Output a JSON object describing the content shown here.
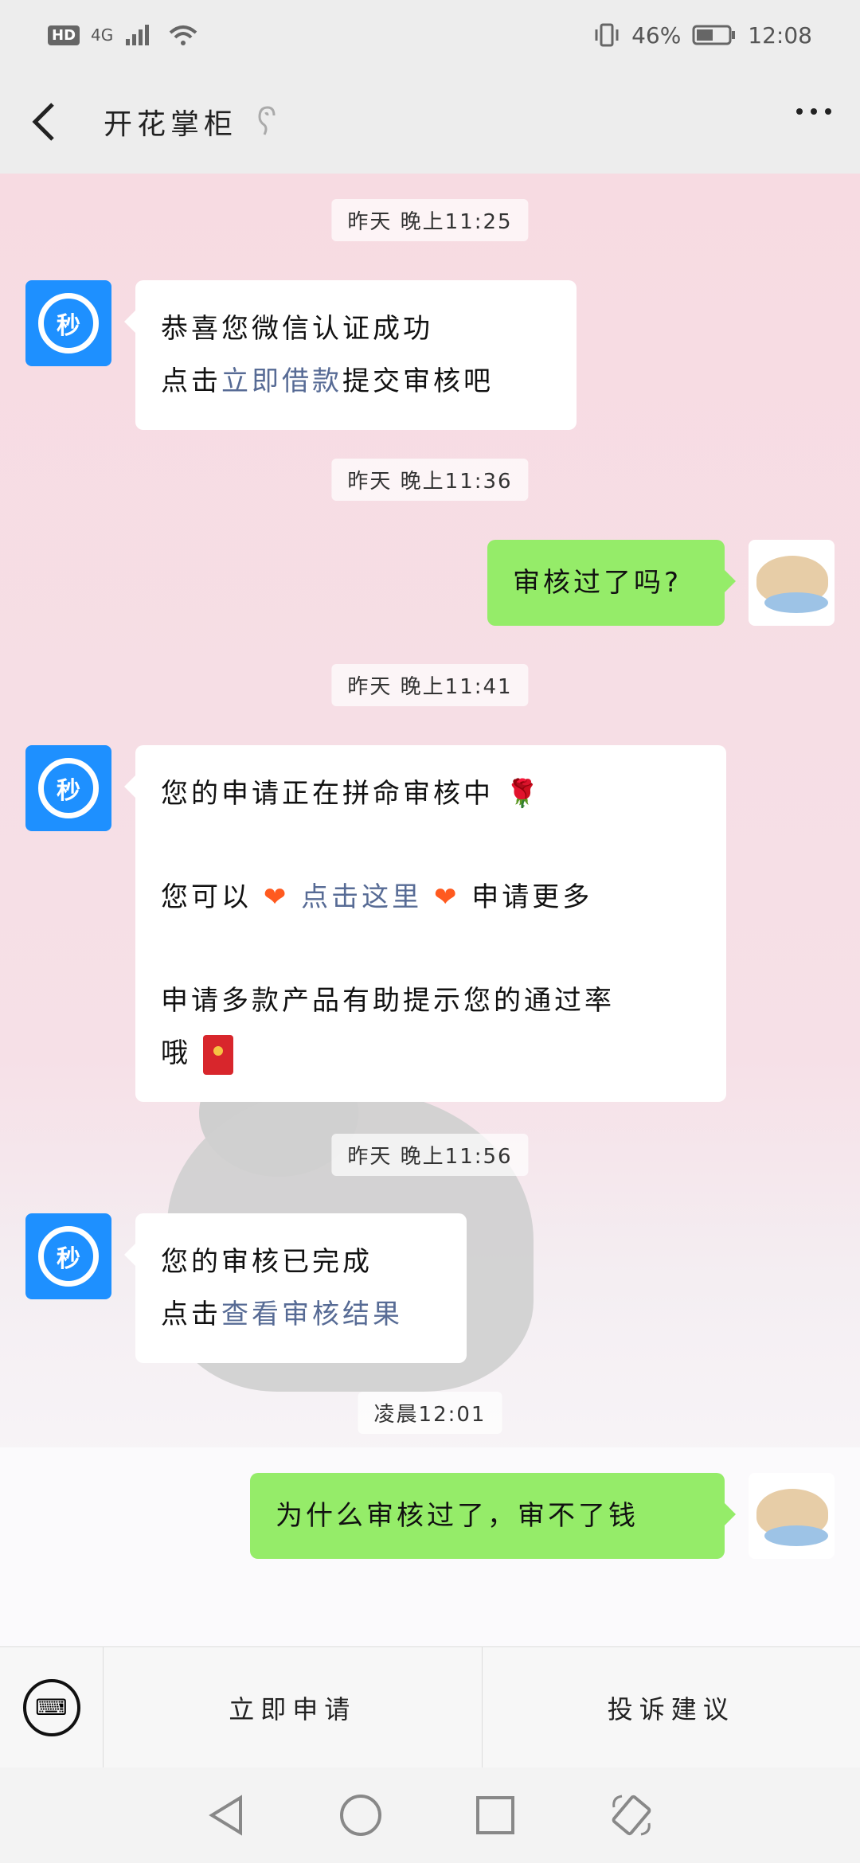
{
  "status_bar": {
    "hd": "HD",
    "network": "4G",
    "battery_percent": "46%",
    "time": "12:08"
  },
  "header": {
    "title": "开花掌柜"
  },
  "messages": {
    "t1": "昨天 晚上11:25",
    "m1_line1": "恭喜您微信认证成功",
    "m1_prefix": "点击",
    "m1_link": "立即借款",
    "m1_suffix": "提交审核吧",
    "t2": "昨天 晚上11:36",
    "m2": "审核过了吗?",
    "t3": "昨天 晚上11:41",
    "m3_line1": "您的申请正在拼命审核中",
    "m3_prefix": "您可以",
    "m3_link": "点击这里",
    "m3_suffix": "申请更多",
    "m3_line3": "申请多款产品有助提示您的通过率",
    "m3_line4": "哦",
    "t4": "昨天 晚上11:56",
    "m4_line1": "您的审核已完成",
    "m4_prefix": "点击",
    "m4_link": "查看审核结果",
    "t5": "凌晨12:01",
    "m5": "为什么审核过了，审不了钱"
  },
  "avatar": {
    "bot_label": "秒"
  },
  "bottom_menu": {
    "apply": "立即申请",
    "complaint": "投诉建议"
  },
  "colors": {
    "green_bubble": "#95ec69",
    "link": "#576b95",
    "bot_avatar": "#1e90ff"
  },
  "icons": {
    "keyboard": "keyboard-icon",
    "back": "chevron-left-icon",
    "more": "more-dots-icon"
  }
}
